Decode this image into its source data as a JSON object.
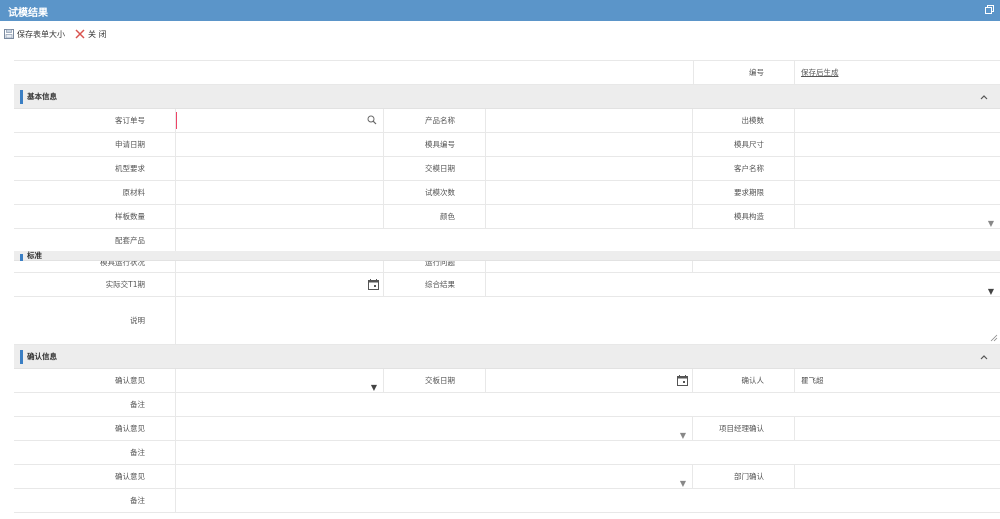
{
  "window": {
    "title": "试模结果"
  },
  "toolbar": {
    "save_size_label": "保存表单大小",
    "close_label": "关 闭"
  },
  "header": {
    "number_label": "编号",
    "number_value": "保存后生成"
  },
  "basic": {
    "title": "基本信息",
    "order_no": "客订单号",
    "product_name": "产品名称",
    "output_count": "出模数",
    "apply_date": "申请日期",
    "mold_no": "模具编号",
    "mold_size": "模具尺寸",
    "machine_req": "机型要求",
    "delivery_date": "交模日期",
    "customer_name": "客户名称",
    "raw_material": "原材料",
    "trial_count": "试模次数",
    "req_date": "要求期限",
    "sample_qty": "样板数量",
    "color": "颜色",
    "mold_structure": "模具构造",
    "matching_product": "配套产品"
  },
  "result": {
    "partial_title": "标准",
    "partial_label_1": "模具运行状况",
    "partial_label_2": "运行问题",
    "actual_t1_date": "实际交T1期",
    "overall_result": "综合结果",
    "description": "说明"
  },
  "confirm": {
    "title": "确认信息",
    "opinion_1": "确认意见",
    "delivery_date": "交板日期",
    "confirmer": "确认人",
    "confirmer_value": "瞿飞超",
    "remark_1": "备注",
    "opinion_2": "确认意见",
    "pm_confirm": "项目经理确认",
    "remark_2": "备注",
    "opinion_3": "确认意见",
    "dept_confirm": "部门确认",
    "remark_3": "备注"
  },
  "icons": {
    "dropdown": "▼",
    "dropdown_grey": "▼",
    "accent": "#5b95c9",
    "section_bar": "#3b7fc4"
  }
}
